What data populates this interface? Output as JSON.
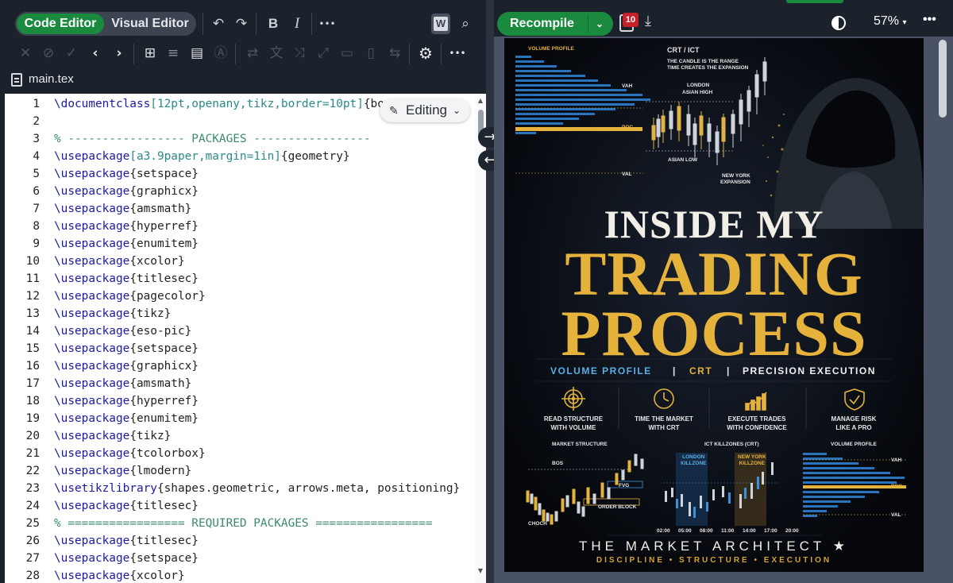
{
  "editor": {
    "mode_toggle": {
      "code_editor": "Code Editor",
      "visual_editor": "Visual Editor"
    },
    "toolbar": {
      "bold": "B",
      "italic": "I",
      "more": "•••"
    },
    "file_name": "main.tex",
    "editing_mode": "Editing",
    "lines": [
      {
        "n": "1",
        "cmd": "\\documentclass",
        "opt": "[12pt,openany,tikz,border=10pt]",
        "arg": "{book}",
        "cmt": ""
      },
      {
        "n": "2",
        "cmd": "",
        "opt": "",
        "arg": "",
        "cmt": ""
      },
      {
        "n": "3",
        "cmd": "",
        "opt": "",
        "arg": "",
        "cmt": "% ----------------- PACKAGES -----------------"
      },
      {
        "n": "4",
        "cmd": "\\usepackage",
        "opt": "[a3.9paper,margin=1in]",
        "arg": "{geometry}",
        "cmt": ""
      },
      {
        "n": "5",
        "cmd": "\\usepackage",
        "opt": "",
        "arg": "{setspace}",
        "cmt": ""
      },
      {
        "n": "6",
        "cmd": "\\usepackage",
        "opt": "",
        "arg": "{graphicx}",
        "cmt": ""
      },
      {
        "n": "7",
        "cmd": "\\usepackage",
        "opt": "",
        "arg": "{amsmath}",
        "cmt": ""
      },
      {
        "n": "8",
        "cmd": "\\usepackage",
        "opt": "",
        "arg": "{hyperref}",
        "cmt": ""
      },
      {
        "n": "9",
        "cmd": "\\usepackage",
        "opt": "",
        "arg": "{enumitem}",
        "cmt": ""
      },
      {
        "n": "10",
        "cmd": "\\usepackage",
        "opt": "",
        "arg": "{xcolor}",
        "cmt": ""
      },
      {
        "n": "11",
        "cmd": "\\usepackage",
        "opt": "",
        "arg": "{titlesec}",
        "cmt": ""
      },
      {
        "n": "12",
        "cmd": "\\usepackage",
        "opt": "",
        "arg": "{pagecolor}",
        "cmt": ""
      },
      {
        "n": "13",
        "cmd": "\\usepackage",
        "opt": "",
        "arg": "{tikz}",
        "cmt": ""
      },
      {
        "n": "14",
        "cmd": "\\usepackage",
        "opt": "",
        "arg": "{eso-pic}",
        "cmt": ""
      },
      {
        "n": "15",
        "cmd": "\\usepackage",
        "opt": "",
        "arg": "{setspace}",
        "cmt": ""
      },
      {
        "n": "16",
        "cmd": "\\usepackage",
        "opt": "",
        "arg": "{graphicx}",
        "cmt": ""
      },
      {
        "n": "17",
        "cmd": "\\usepackage",
        "opt": "",
        "arg": "{amsmath}",
        "cmt": ""
      },
      {
        "n": "18",
        "cmd": "\\usepackage",
        "opt": "",
        "arg": "{hyperref}",
        "cmt": ""
      },
      {
        "n": "19",
        "cmd": "\\usepackage",
        "opt": "",
        "arg": "{enumitem}",
        "cmt": ""
      },
      {
        "n": "20",
        "cmd": "\\usepackage",
        "opt": "",
        "arg": "{tikz}",
        "cmt": ""
      },
      {
        "n": "21",
        "cmd": "\\usepackage",
        "opt": "",
        "arg": "{tcolorbox}",
        "cmt": ""
      },
      {
        "n": "22",
        "cmd": "\\usepackage",
        "opt": "",
        "arg": "{lmodern}",
        "cmt": ""
      },
      {
        "n": "23",
        "cmd": "\\usetikzlibrary",
        "opt": "",
        "arg": "{shapes.geometric, arrows.meta, positioning}",
        "cmt": ""
      },
      {
        "n": "24",
        "cmd": "\\usepackage",
        "opt": "",
        "arg": "{titlesec}",
        "cmt": ""
      },
      {
        "n": "25",
        "cmd": "",
        "opt": "",
        "arg": "",
        "cmt": "% ================= REQUIRED PACKAGES ================="
      },
      {
        "n": "26",
        "cmd": "\\usepackage",
        "opt": "",
        "arg": "{titlesec}",
        "cmt": ""
      },
      {
        "n": "27",
        "cmd": "\\usepackage",
        "opt": "",
        "arg": "{setspace}",
        "cmt": ""
      },
      {
        "n": "28",
        "cmd": "\\usepackage",
        "opt": "",
        "arg": "{xcolor}",
        "cmt": ""
      }
    ]
  },
  "preview": {
    "recompile_label": "Recompile",
    "logs_badge": "10",
    "zoom": "57%",
    "more": "•••",
    "poster": {
      "volume_profile_top": "VOLUME PROFILE",
      "vah": "VAH",
      "poc": "POC",
      "val": "VAL",
      "crt_title": "CRT / ICT",
      "crt_sub1": "THE CANDLE IS THE RANGE",
      "crt_sub2": "TIME CREATES THE EXPANSION",
      "london": "LONDON",
      "asian_high": "ASIAN HIGH",
      "asian_low": "ASIAN LOW",
      "new_york": "NEW YORK",
      "expansion": "EXPANSION",
      "title_line1": "INSIDE MY",
      "title_line2": "TRADING",
      "title_line3": "PROCESS",
      "sub_a": "VOLUME PROFILE",
      "sub_sep1": "|",
      "sub_b": "CRT",
      "sub_sep2": "|",
      "sub_c": "PRECISION EXECUTION",
      "features": [
        "READ STRUCTURE\nWITH VOLUME",
        "TIME THE MARKET\nWITH CRT",
        "EXECUTE TRADES\nWITH CONFIDENCE",
        "MANAGE RISK\nLIKE A PRO"
      ],
      "market_structure": "MARKET STRUCTURE",
      "bos": "BOS",
      "fvg": "FVG",
      "order_block": "ORDER BLOCK",
      "choch": "CHOCH",
      "killzones": "ICT KILLZONES (CRT)",
      "london_killzone": "LONDON\nKILLZONE",
      "ny_killzone": "NEW YORK\nKILLZONE",
      "times": [
        "02:00",
        "05:00",
        "08:00",
        "11:00",
        "14:00",
        "17:00",
        "20:00"
      ],
      "volume_profile_bottom": "VOLUME PROFILE",
      "vah2": "VAH",
      "poc2": "POC",
      "val2": "VAL",
      "brand": "THE MARKET ARCHITECT ★",
      "tagline": "DISCIPLINE • STRUCTURE • EXECUTION"
    }
  },
  "colors": {
    "accent_green": "#198a3e",
    "gold": "#e5b23c",
    "blue": "#3f8fd6",
    "badge_red": "#c7222a"
  }
}
